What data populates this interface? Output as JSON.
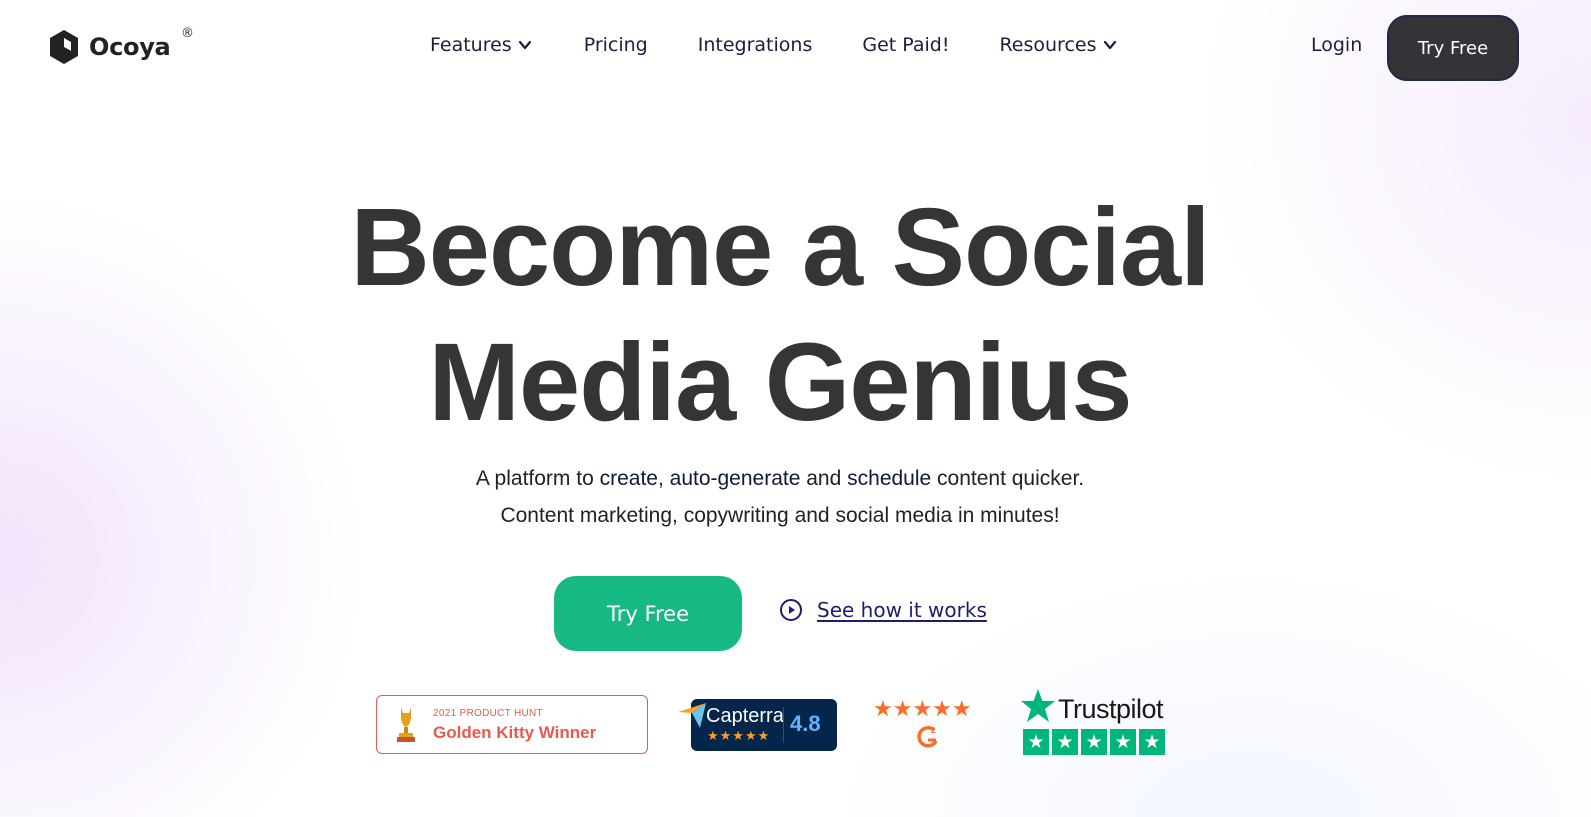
{
  "nav": {
    "brand": "Ocoya",
    "brand_mark": "®",
    "items": [
      {
        "label": "Features",
        "has_dropdown": true
      },
      {
        "label": "Pricing",
        "has_dropdown": false
      },
      {
        "label": "Integrations",
        "has_dropdown": false
      },
      {
        "label": "Get Paid!",
        "has_dropdown": false
      },
      {
        "label": "Resources",
        "has_dropdown": true
      }
    ],
    "login_label": "Login",
    "try_free_label": "Try Free"
  },
  "hero": {
    "title_line1": "Become a Social",
    "title_line2": "Media Genius",
    "subtitle": {
      "l1_a": "A platform to ",
      "l1_b": "create",
      "l1_c": ", ",
      "l1_d": "auto-generate",
      "l1_e": " and ",
      "l1_f": "schedule",
      "l1_g": " content quicker.",
      "line2": "Content marketing, copywriting and social media in minutes!"
    },
    "cta_label": "Try Free",
    "video_link_label": "See how it works"
  },
  "badges": {
    "product_hunt": {
      "top": "2021 PRODUCT HUNT",
      "title": "Golden Kitty Winner"
    },
    "capterra": {
      "name": "Capterra",
      "stars": "★★★★★",
      "rating": "4.8"
    },
    "g2": {
      "stars": "★★★★★"
    },
    "trustpilot": {
      "name": "Trustpilot",
      "star": "★"
    }
  },
  "colors": {
    "cta_green": "#16b884",
    "dark_button": "#333338",
    "link_blue": "#1b1e6b",
    "product_hunt_red": "#e9594e",
    "trustpilot_green": "#00b67a",
    "g2_orange": "#ff6b2b"
  }
}
